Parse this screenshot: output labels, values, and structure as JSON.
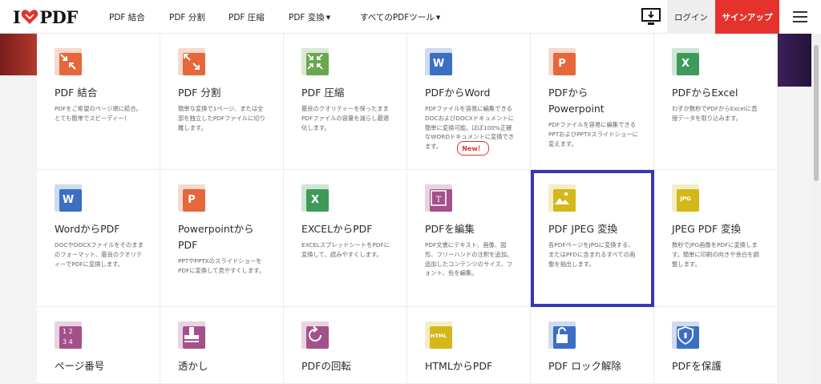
{
  "header": {
    "logo_text_left": "I",
    "logo_text_right": "PDF",
    "nav": [
      {
        "label": "PDF 結合",
        "caret": false
      },
      {
        "label": "PDF 分割",
        "caret": false
      },
      {
        "label": "PDF 圧縮",
        "caret": false
      },
      {
        "label": "PDF 変換",
        "caret": true
      },
      {
        "label": "すべてのPDFツール",
        "caret": true
      }
    ],
    "login_label": "ログイン",
    "signup_label": "サインアップ"
  },
  "new_badge": "New！",
  "tools": [
    {
      "title": "PDF 結合",
      "desc": "PDFをご希望のページ順に結合。とても簡単でスピーディー！",
      "icon": "merge-icon",
      "color": "#e5673a"
    },
    {
      "title": "PDF 分割",
      "desc": "簡単な変換で1ページ、または全部を独立したPDFファイルに切り離します。",
      "icon": "split-icon",
      "color": "#e5673a"
    },
    {
      "title": "PDF 圧縮",
      "desc": "最良のクオリティーを保ったままPDFファイルの容量を減らし最適化します。",
      "icon": "compress-icon",
      "color": "#6aa84f"
    },
    {
      "title": "PDFからWord",
      "desc": "PDFファイルを容易に編集できるDOCおよびDOCXドキュメントに簡単に変換可能。ほぼ100%正確なWORDドキュメントに変換できます。",
      "icon": "pdf-to-word-icon",
      "color": "#3a6fc4"
    },
    {
      "title": "PDFから Powerpoint",
      "desc": "PDFファイルを容易に編集できるPPTおよびPPTXスライドショーに変えます。",
      "icon": "pdf-to-powerpoint-icon",
      "color": "#e5673a"
    },
    {
      "title": "PDFからExcel",
      "desc": "わずか数秒でPDFからExcelに直接データを取り込みます。",
      "icon": "pdf-to-excel-icon",
      "color": "#3d9a5b"
    },
    {
      "title": "WordからPDF",
      "desc": "DOCやDOCXファイルをそのままのフォーマット、最良のクオリティーでPDFに変換します。",
      "icon": "word-to-pdf-icon",
      "color": "#3a6fc4"
    },
    {
      "title": "Powerpointから PDF",
      "desc": "PPTやPPTXのスライドショーをPDFに変換して見やすくします。",
      "icon": "powerpoint-to-pdf-icon",
      "color": "#e5673a"
    },
    {
      "title": "EXCELからPDF",
      "desc": "EXCELスプレッドシートをPDFに変換して、読みやすくします。",
      "icon": "excel-to-pdf-icon",
      "color": "#3d9a5b"
    },
    {
      "title": "PDFを編集",
      "desc": "PDF文書にテキスト、画像、図形、フリーハンドの注釈を追加。追加したコンテンツのサイズ、フォント、色を編集。",
      "icon": "edit-pdf-icon",
      "color": "#a4508b"
    },
    {
      "title": "PDF JPEG 変換",
      "desc": "各PDFページをJPGに変換する、またはPFDに含まれるすべての画像を抽出します。",
      "icon": "pdf-to-jpg-icon",
      "color": "#d4b81a"
    },
    {
      "title": "JPEG PDF 変換",
      "desc": "数秒でJPG画像をPDFに変換します。簡単に印刷の向きや余白を調整します。",
      "icon": "jpg-to-pdf-icon",
      "color": "#d4b81a"
    },
    {
      "title": "ページ番号",
      "desc": "",
      "icon": "page-numbers-icon",
      "color": "#a4508b"
    },
    {
      "title": "透かし",
      "desc": "",
      "icon": "watermark-icon",
      "color": "#a4508b"
    },
    {
      "title": "PDFの回転",
      "desc": "",
      "icon": "rotate-icon",
      "color": "#a4508b"
    },
    {
      "title": "HTMLからPDF",
      "desc": "",
      "icon": "html-to-pdf-icon",
      "color": "#d4b81a"
    },
    {
      "title": "PDF ロック解除",
      "desc": "",
      "icon": "unlock-icon",
      "color": "#3a6fc4"
    },
    {
      "title": "PDFを保護",
      "desc": "",
      "icon": "protect-icon",
      "color": "#3a6fc4"
    }
  ]
}
